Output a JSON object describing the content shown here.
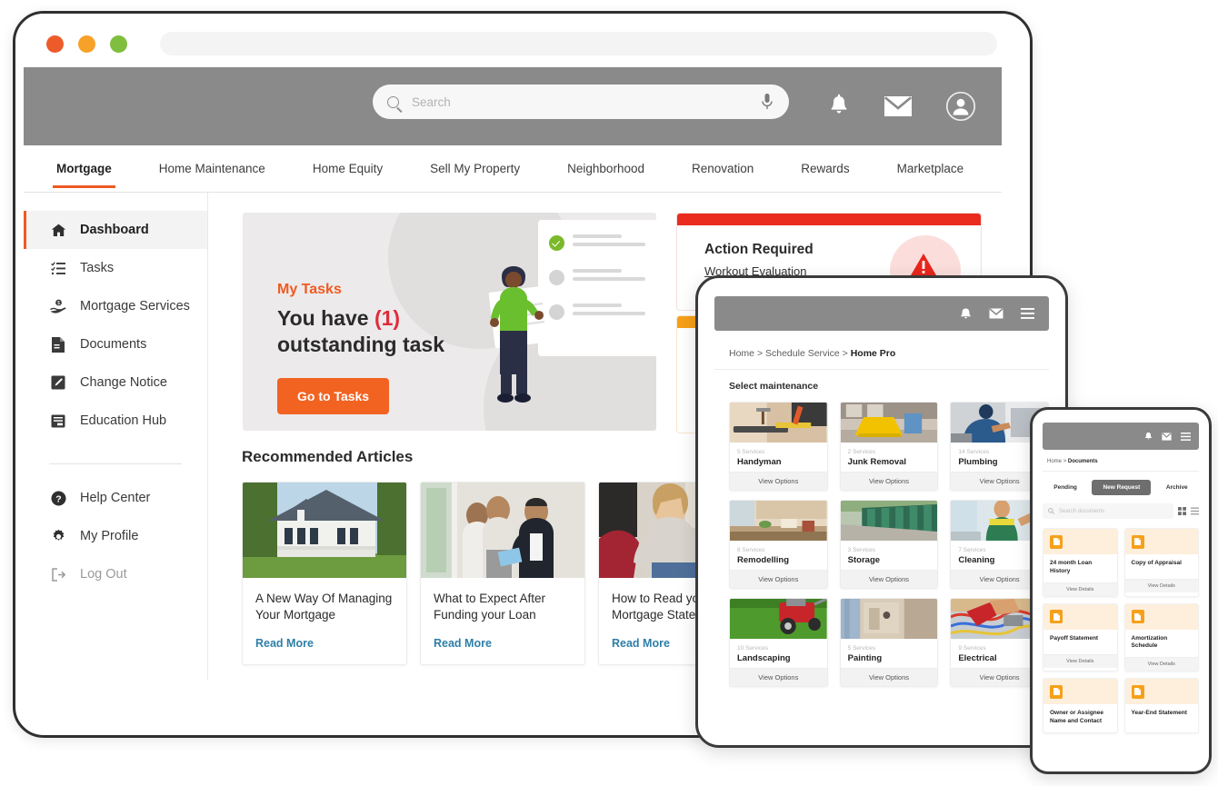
{
  "browser": {
    "dots": [
      "close-red",
      "minimize-amber",
      "maximize-green"
    ],
    "url_value": ""
  },
  "header": {
    "search": {
      "placeholder": "Search",
      "value": ""
    },
    "icons": [
      "bell-icon",
      "envelope-icon",
      "user-avatar-icon"
    ]
  },
  "tabs": [
    {
      "label": "Mortgage",
      "active": true
    },
    {
      "label": "Home Maintenance",
      "active": false
    },
    {
      "label": "Home Equity",
      "active": false
    },
    {
      "label": "Sell My Property",
      "active": false
    },
    {
      "label": "Neighborhood",
      "active": false
    },
    {
      "label": "Renovation",
      "active": false
    },
    {
      "label": "Rewards",
      "active": false
    },
    {
      "label": "Marketplace",
      "active": false
    }
  ],
  "sidebar": {
    "items": [
      {
        "label": "Dashboard",
        "icon": "home-icon",
        "active": true
      },
      {
        "label": "Tasks",
        "icon": "checklist-icon",
        "active": false
      },
      {
        "label": "Mortgage Services",
        "icon": "hand-money-icon",
        "active": false
      },
      {
        "label": "Documents",
        "icon": "document-icon",
        "active": false
      },
      {
        "label": "Change Notice",
        "icon": "pencil-square-icon",
        "active": false
      },
      {
        "label": "Education Hub",
        "icon": "book-icon",
        "active": false
      }
    ],
    "footer_items": [
      {
        "label": "Help Center",
        "icon": "question-circle-icon"
      },
      {
        "label": "My Profile",
        "icon": "gear-icon"
      },
      {
        "label": "Log Out",
        "icon": "logout-icon"
      }
    ]
  },
  "hero": {
    "kicker": "My Tasks",
    "title_prefix": "You have ",
    "count": "(1)",
    "title_suffix": "outstanding task",
    "button": "Go to Tasks"
  },
  "action_card": {
    "title": "Action Required",
    "subtitle": "Workout Evaluation",
    "accent_color": "#EA2C1E",
    "icon": "warning-triangle-icon"
  },
  "action_card2": {
    "accent_color": "#F6A01A"
  },
  "recommended": {
    "heading": "Recommended Articles",
    "link_label": "Read More",
    "articles": [
      {
        "title": "A New Way Of Managing Your Mortgage",
        "image": "house-exterior"
      },
      {
        "title": "What to Expect After Funding your Loan",
        "image": "agent-handing-keys"
      },
      {
        "title": "How to Read your Mortgage Statement",
        "image": "woman-on-couch"
      }
    ]
  },
  "tablet": {
    "icons": [
      "bell-icon",
      "envelope-icon",
      "hamburger-menu-icon"
    ],
    "breadcrumb": {
      "items": [
        "Home",
        "Schedule Service"
      ],
      "current": "Home Pro",
      "sep": ">"
    },
    "section_title": "Select maintenance",
    "view_options_label": "View Options",
    "services": [
      {
        "count": "5 Services",
        "name": "Handyman",
        "image": "tools-on-wood"
      },
      {
        "count": "2 Services",
        "name": "Junk Removal",
        "image": "yellow-skip-bin"
      },
      {
        "count": "14 Services",
        "name": "Plumbing",
        "image": "plumber-working"
      },
      {
        "count": "8 Services",
        "name": "Remodelling",
        "image": "modern-kitchen"
      },
      {
        "count": "3 Services",
        "name": "Storage",
        "image": "storage-units"
      },
      {
        "count": "7 Services",
        "name": "Cleaning",
        "image": "cleaner-spraying"
      },
      {
        "count": "10 Services",
        "name": "Landscaping",
        "image": "lawn-mower-grass"
      },
      {
        "count": "5 Services",
        "name": "Painting",
        "image": "painter-brush"
      },
      {
        "count": "9 Services",
        "name": "Electrical",
        "image": "electrician-wires"
      }
    ]
  },
  "phone": {
    "icons": [
      "bell-icon",
      "envelope-icon",
      "hamburger-menu-icon"
    ],
    "breadcrumb": {
      "items": [
        "Home"
      ],
      "current": "Documents",
      "sep": ">"
    },
    "tabs": [
      {
        "label": "Pending",
        "selected": false
      },
      {
        "label": "New Request",
        "selected": true
      },
      {
        "label": "Archive",
        "selected": false
      }
    ],
    "search": {
      "placeholder": "Search documents",
      "value": ""
    },
    "view_toggles": [
      "grid-view-icon",
      "list-view-icon"
    ],
    "view_details_label": "View Details",
    "documents": [
      {
        "name": "24 month Loan History"
      },
      {
        "name": "Copy of Appraisal"
      },
      {
        "name": "Payoff Statement"
      },
      {
        "name": "Amortization Schedule"
      },
      {
        "name": "Owner or Assignee Name and Contact"
      },
      {
        "name": "Year-End Statement"
      }
    ]
  }
}
